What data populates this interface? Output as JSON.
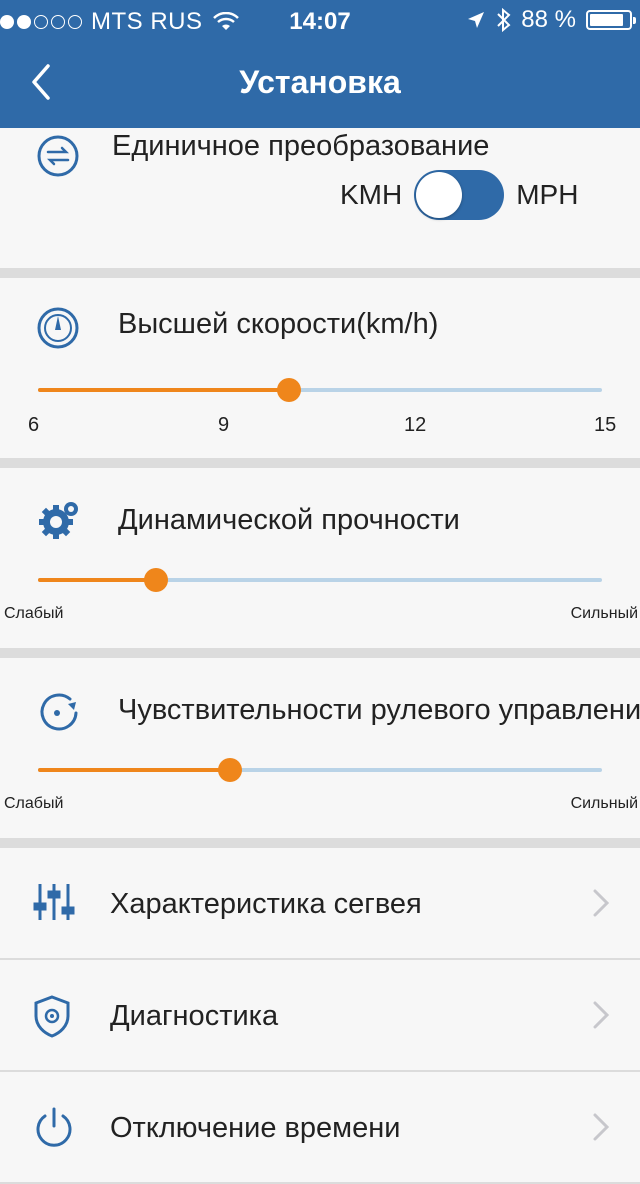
{
  "status_bar": {
    "signal_filled": 2,
    "signal_total": 5,
    "carrier": "MTS RUS",
    "time": "14:07",
    "battery": "88 %",
    "battery_level_pct": 88
  },
  "header": {
    "title": "Установка",
    "back_icon": "chevron-left-icon"
  },
  "unit_section": {
    "title": "Единичное преобразование",
    "left_label": "KMH",
    "right_label": "MPH",
    "toggle_on": true,
    "icon": "unit-convert-icon"
  },
  "top_speed": {
    "title": "Высшей скорости(km/h)",
    "icon": "speedometer-icon",
    "ticks": [
      "6",
      "9",
      "12",
      "15"
    ],
    "min": 6,
    "max": 15,
    "value": 10
  },
  "dynamic_strength": {
    "title": "Динамической прочности",
    "icon": "gears-icon",
    "min_label": "Слабый",
    "max_label": "Сильный",
    "value_fraction": 0.21
  },
  "steering_sensitivity": {
    "title": "Чувствительности рулевого управления",
    "icon": "rotate-icon",
    "min_label": "Слабый",
    "max_label": "Сильный",
    "value_fraction": 0.34
  },
  "menu": [
    {
      "label": "Характеристика сегвея",
      "icon": "sliders-icon"
    },
    {
      "label": "Диагностика",
      "icon": "shield-gear-icon"
    },
    {
      "label": "Отключение времени",
      "icon": "power-icon"
    }
  ],
  "colors": {
    "header": "#2f6aa8",
    "accent": "#ef861b",
    "track": "#b9d3e7",
    "icon": "#2f6aa8"
  }
}
